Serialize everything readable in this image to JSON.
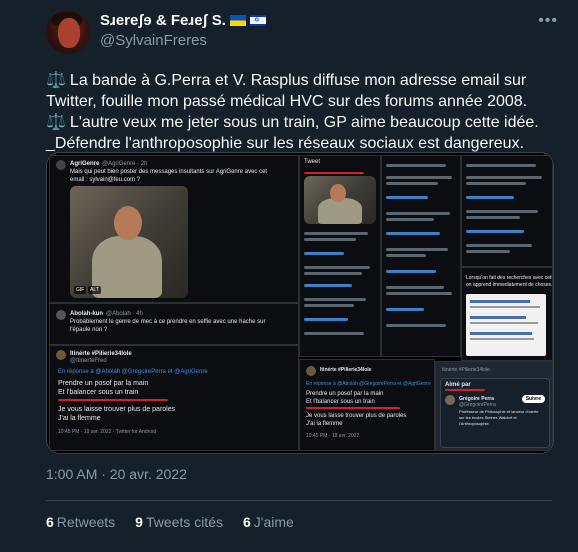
{
  "author": {
    "display_name": "S.Feɹeʃ & Fɹeʃeʃ S.",
    "display_name_mirror": "Sɹereʃɘ & Feɹeʃ S.",
    "handle": "@SylvainFreres",
    "flag_il_star": "✡"
  },
  "more_label": "•••",
  "tweet": {
    "line1": "La bande à G.Perra et V. Rasplus diffuse mon adresse email sur Twitter, fouille mon passé médical HVC sur des forums année 2008.",
    "line2": "L'autre veux me jeter sous un train, GP aime beaucoup cette idée.",
    "line3": "_Défendre l'anthroposophie sur les réseaux sociaux est dangereux.",
    "scales_icon": "⚖️"
  },
  "media": {
    "panel1": {
      "author": "AgriGenre",
      "handle": "@AgriGenre · 2h",
      "text1": "Mais qui peut bien poster des messages insultants sur AgriGenre avec cet",
      "text2": "email : sylvain@feu.com ?",
      "badges": [
        "GIF",
        "ALT"
      ]
    },
    "panel2": {
      "author": "Abolah-kun",
      "handle": "@Abolah · 4h",
      "text1": "Probablement le genre de mec à ce prendre en selfie avec une hache sur",
      "text2": "l'épaule non ?"
    },
    "panel3": {
      "author": "Itinérte #Pilierie34lole",
      "handle": "@ItinerteFred",
      "reply_to": "En réponse à @Abolah @GregoirePerra et @AgriGenre",
      "line1": "Prendre un posof par la main",
      "line2": "Et l'balancer sous un train",
      "line3": "Je vous laisse trouver plus de paroles",
      "line4": "J'ai la flemme",
      "meta": "10:45 PM · 19 avr. 2022 · Twitter for Android"
    },
    "panel4": {
      "header": "Tweet",
      "line1": "Prendre un posof par la main",
      "line2": "Et l'balancer sous un train",
      "line3": "Je vous laisse trouver plus de paroles",
      "line4": "J'ai la flemme",
      "meta": "10:45 PM · 19 avr. 2022"
    },
    "panel5": {
      "liked_by": "Aimé par",
      "user": "Grégoire Perra",
      "handle": "@GregoirePerra",
      "bio": "Professeur de Philosophie et lanceur d'alerte sur les écoles Steiner-Waldorf et l'Anthroposophie",
      "follow": "Suivre"
    },
    "panel6": {
      "line1": "Lorsqu'on fait des recherches avec cette adresse mail,",
      "line2": "on apprend immediatement de choses..."
    }
  },
  "timestamp": "1:00 AM · 20 avr. 2022",
  "stats": [
    {
      "count": "6",
      "label": "Retweets"
    },
    {
      "count": "9",
      "label": "Tweets cités"
    },
    {
      "count": "6",
      "label": "J'aime"
    }
  ]
}
